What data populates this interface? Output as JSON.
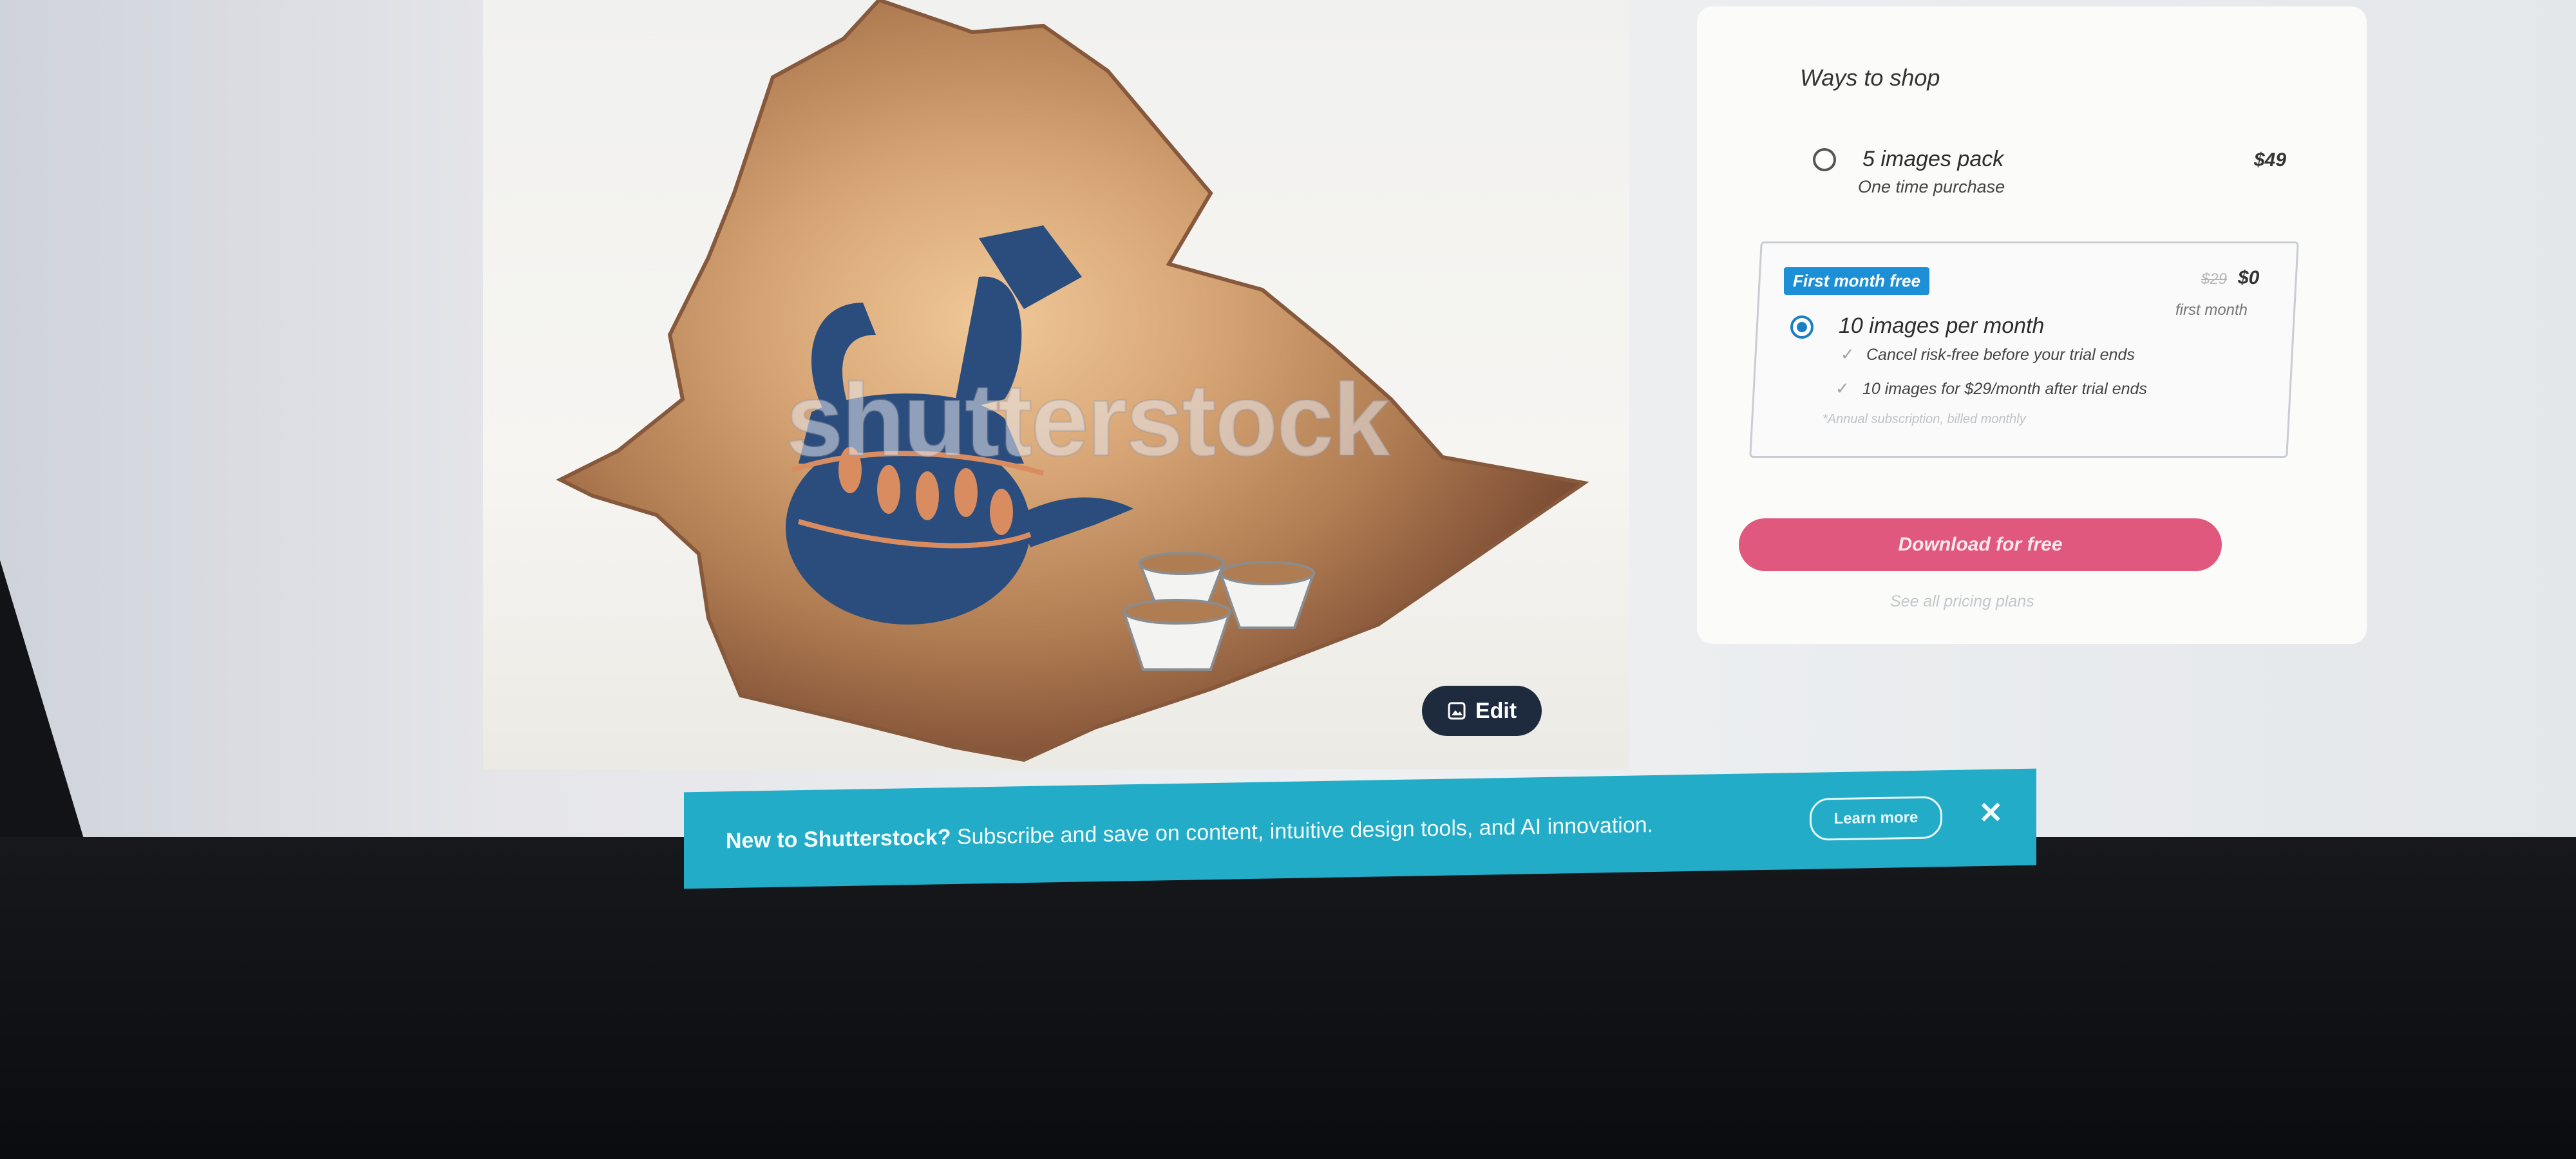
{
  "image_preview": {
    "watermark": "shutterstock",
    "edit_label": "Edit"
  },
  "shop": {
    "title": "Ways to shop",
    "pack": {
      "name": "5 images pack",
      "subtitle": "One time purchase",
      "price": "$49"
    },
    "subscription": {
      "badge": "First month free",
      "old_price": "$29",
      "new_price": "$0",
      "price_note": "first month",
      "name": "10 images per month",
      "benefits": [
        "Cancel risk-free before your trial ends",
        "10 images for $29/month after trial ends"
      ],
      "fine_print": "*Annual subscription, billed monthly"
    },
    "download_label": "Download for free",
    "pricing_link": "See all pricing plans"
  },
  "promo": {
    "lead": "New to Shutterstock?",
    "text": "Subscribe and save on content, intuitive design tools, and AI innovation.",
    "learn_more": "Learn more",
    "close": "✕"
  },
  "colors": {
    "accent_blue": "#1c8fd6",
    "download_pink": "#e0587d",
    "banner_teal": "#22acc7",
    "edit_navy": "#1e2b3f"
  }
}
